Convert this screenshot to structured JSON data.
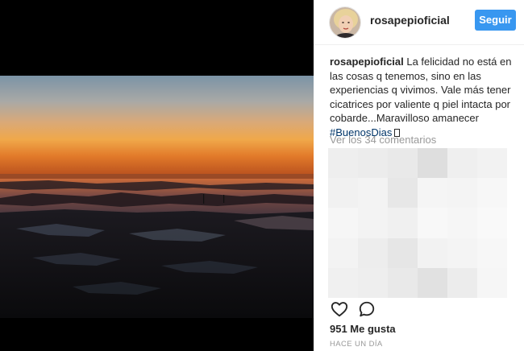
{
  "post": {
    "username": "rosapepioficial",
    "follow_label": "Seguir",
    "caption_user": "rosapepioficial",
    "caption_text": " La felicidad no está en las cosas q tenemos, sino en las experiencias q vivimos. Vale más tener cicatrices por valiente q piel intacta por cobarde...Maravilloso amanecer ",
    "hashtag": "#BuenosDias",
    "view_comments": "Ver los 34 comentarios",
    "likes": "951 Me gusta",
    "timestamp": "HACE UN DÍA"
  },
  "icons": {
    "like": "heart-icon",
    "comment": "comment-icon"
  },
  "colors": {
    "follow_button": "#3897f0",
    "hashtag": "#003569",
    "muted_text": "#999999"
  },
  "mosaic_shades": [
    "#eeeeee",
    "#ececec",
    "#e9e9e9",
    "#dedede",
    "#efefef",
    "#f2f2f2",
    "#f1f1f1",
    "#f3f3f3",
    "#e7e7e7",
    "#f5f5f5",
    "#f4f4f4",
    "#f7f7f7",
    "#f6f6f6",
    "#f3f3f3",
    "#f0f0f0",
    "#f8f8f8",
    "#f6f6f6",
    "#f9f9f9",
    "#f3f3f3",
    "#ededed",
    "#e6e6e6",
    "#f2f2f2",
    "#f4f4f4",
    "#f7f7f7",
    "#f0f0f0",
    "#eeeeee",
    "#e9e9e9",
    "#e1e1e1",
    "#ececec",
    "#f6f6f6"
  ]
}
